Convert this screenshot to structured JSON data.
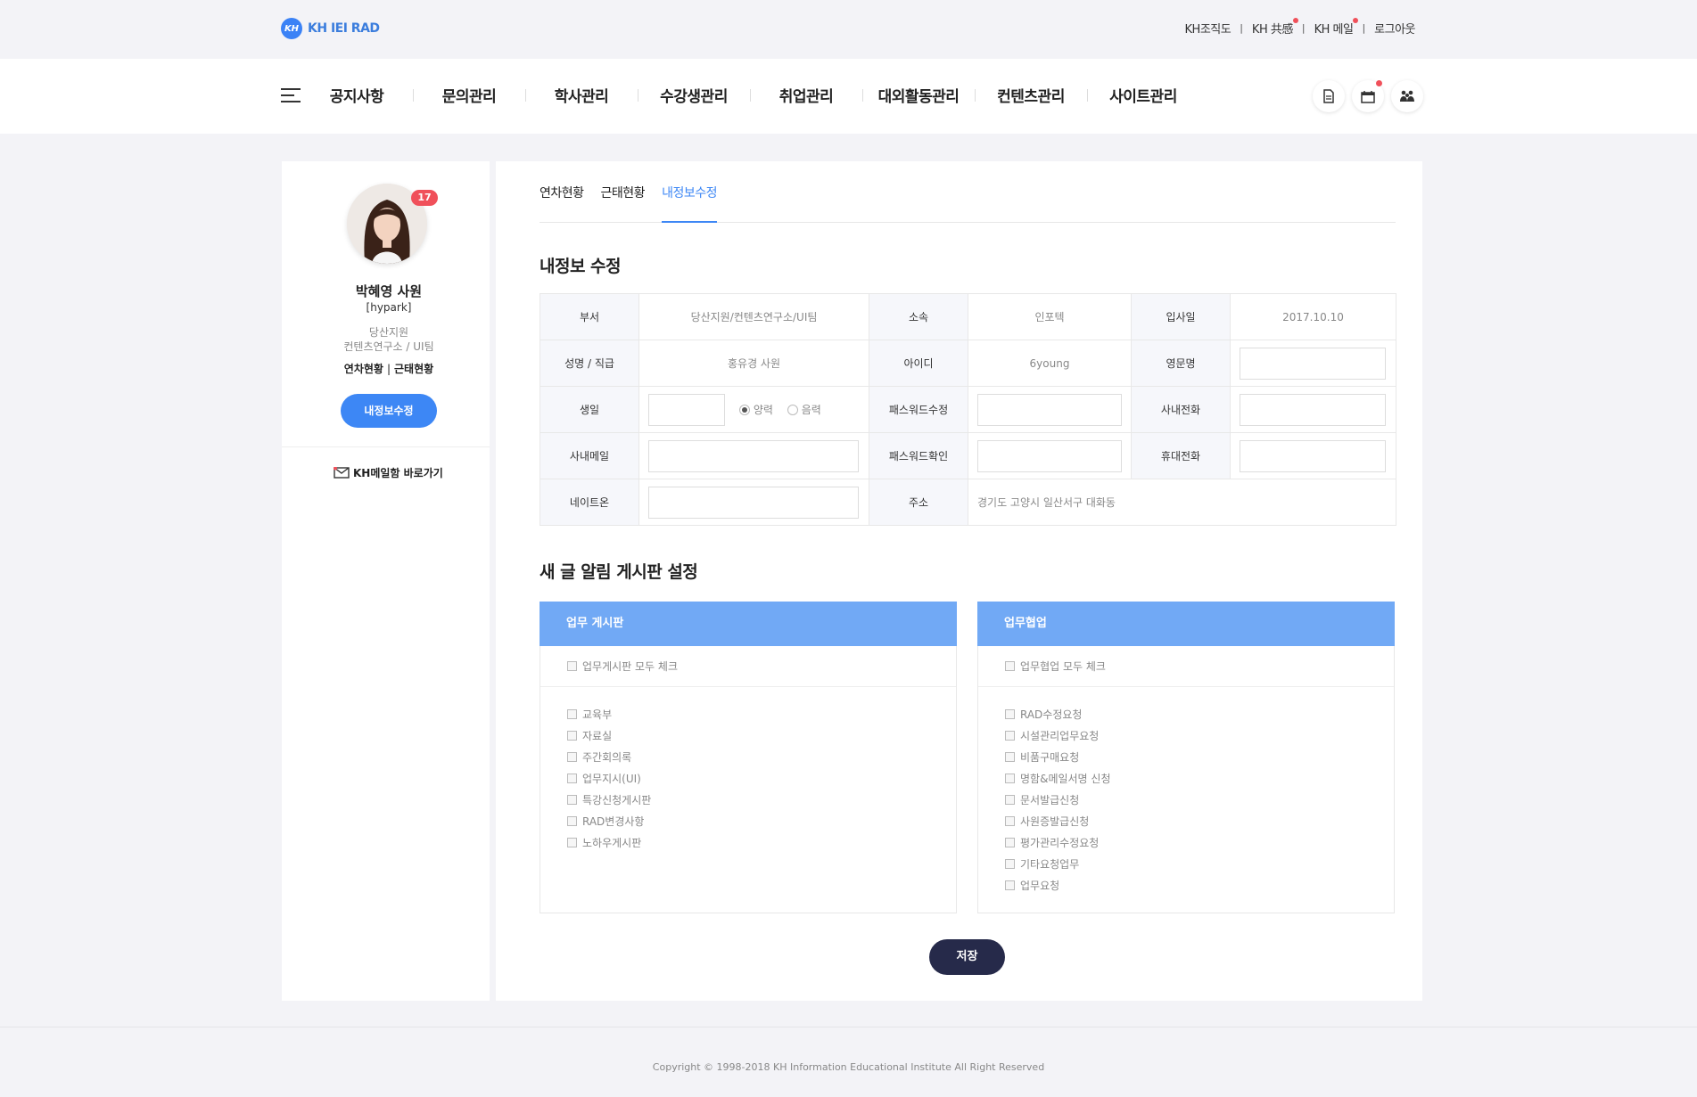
{
  "topbar": {
    "logo_badge": "KH",
    "logo_text": "KH IEI RAD",
    "links": [
      "KH조직도",
      "KH 共感",
      "KH 메일",
      "로그아웃"
    ],
    "separator": "|"
  },
  "gnb": {
    "menu": [
      "공지사항",
      "문의관리",
      "학사관리",
      "수강생관리",
      "취업관리",
      "대외활동관리",
      "컨텐츠관리",
      "사이트관리"
    ],
    "icons": [
      "document-icon",
      "calendar-icon",
      "people-icon"
    ]
  },
  "sidebar": {
    "badge_count": "17",
    "name": "박혜영 사원",
    "user_id": "[hypark]",
    "dept_line1": "당산지원",
    "dept_line2": "컨텐츠연구소 / UI팀",
    "link_annual": "연차현황",
    "link_attendance": "근태현황",
    "link_sep": "|",
    "edit_button": "내정보수정",
    "mail_link": "KH메일함 바로가기"
  },
  "tabs": [
    "연차현황",
    "근태현황",
    "내정보수정"
  ],
  "active_tab": "내정보수정",
  "section_info_title": "내정보 수정",
  "info": {
    "dept_label": "부서",
    "dept_value": "당산지원/컨텐츠연구소/UI팀",
    "affil_label": "소속",
    "affil_value": "인포텍",
    "join_label": "입사일",
    "join_value": "2017.10.10",
    "name_label": "성명 / 직급",
    "name_value": "홍유경 사원",
    "id_label": "아이디",
    "id_value": "6young",
    "eng_label": "영문명",
    "birth_label": "생일",
    "solar_label": "양력",
    "lunar_label": "음력",
    "pw_label": "패스워드수정",
    "tel_label": "사내전화",
    "mail_label": "사내메일",
    "pwc_label": "패스워드확인",
    "mobile_label": "휴대전화",
    "nate_label": "네이트온",
    "addr_label": "주소",
    "addr_value": "경기도 고양시 일산서구 대화동"
  },
  "section_board_title": "새 글 알림 게시판 설정",
  "board_work": {
    "title": "업무 게시판",
    "all_label": "업무게시판 모두 체크",
    "items": [
      "교육부",
      "자료실",
      "주간회의록",
      "업무지시(UI)",
      "특강신청게시판",
      "RAD변경사항",
      "노하우게시판"
    ]
  },
  "board_coop": {
    "title": "업무협업",
    "all_label": "업무협업 모두 체크",
    "items": [
      "RAD수정요청",
      "시설관리업무요청",
      "비품구매요청",
      "명함&메일서명 신청",
      "문서발급신청",
      "사원증발급신청",
      "평가관리수정요청",
      "기타요청업무",
      "업무요청"
    ]
  },
  "save_button": "저장",
  "footer": "Copyright © 1998-2018 KH Information Educational Institute All Right Reserved",
  "colors": {
    "accent": "#3d87f5",
    "board_head": "#71a9f5",
    "save": "#262a4a",
    "alert": "#f0505a"
  }
}
